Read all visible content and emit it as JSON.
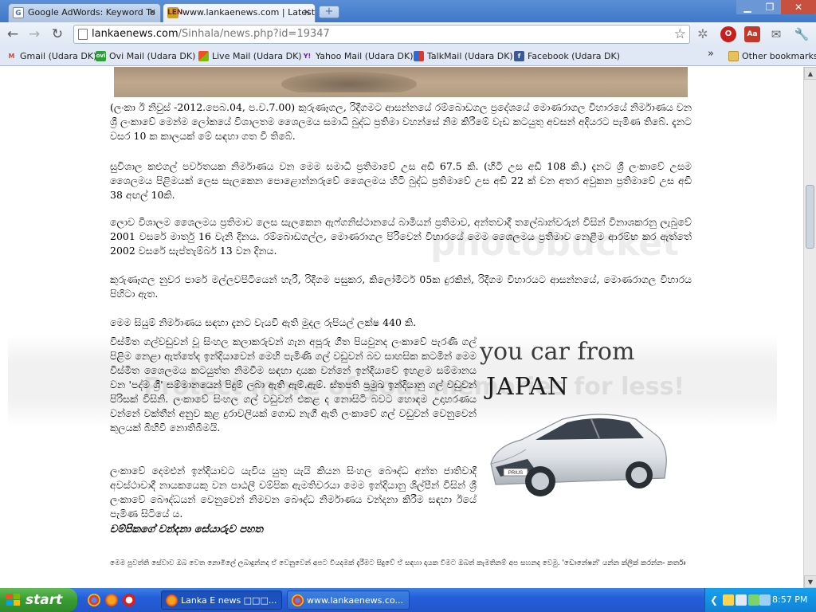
{
  "browser": {
    "tabs": [
      {
        "title": "Google AdWords: Keyword To",
        "favicon": "G",
        "active": false
      },
      {
        "title": "www.lankaenews.com | Latest",
        "favicon": "LEN",
        "active": true
      }
    ],
    "new_tab": "+",
    "url_host": "lankaenews.com",
    "url_path": "/Sinhala/news.php?id=19347"
  },
  "bookmarks": [
    {
      "label": "Gmail (Udara DK)",
      "icon": "M"
    },
    {
      "label": "Ovi Mail (Udara DK)",
      "icon": "ovi"
    },
    {
      "label": "Live Mail (Udara DK)",
      "icon": "W"
    },
    {
      "label": "Yahoo Mail (Udara DK)",
      "icon": "Y!"
    },
    {
      "label": "TalkMail (Udara DK)",
      "icon": "T"
    },
    {
      "label": "Facebook (Udara DK)",
      "icon": "f"
    }
  ],
  "other_bookmarks": "Other bookmarks",
  "article": {
    "p1": "(ලංකා ඊ නිවුස් -2012.පෙබ.04, ප.ව.7.00) කුරුණෑගල, රිදීගමට ආසන්නයේ රම්බොඩගල ප්‍රදේශයේ මොණරාගල විහාරයේ නිර්මාණය වන ශ්‍රී ලංකාවේ මෙන්ම ලෝකයේ විශාලතම ශෛලමය සමාධි බුද්ධ ප්‍රතිමා වහන්සේ නිම කිරීමේ වැඩ කටයුතු අවසන් අදියරට පැමිණ තිබේ. දැනට වසර 10 ක කාලයක් මේ සඳහා ගත වී තිබේ.",
    "p2": "සුවිශාල කළුගල් පර්වතයක නිර්මාණය වන මෙම සමාධි ප්‍රතිමාවේ උස අඩි 67.5 කි. (හිටි උස අඩි 108 කි.) දැනට ශ්‍රී ලංකාවේ උසම ශෛලමය පිළිමයක් ලෙස සැලකෙන පොළොන්නරුවේ ශෛලමය හිටි බුද්ධ ප්‍රතිමාවේ උස අඩි 22 ක් වන අතර අවුකන ප්‍රතිමාවේ උස අඩි 38 අඟල් 10කි.",
    "p3": "ලොව විශාලම ශෛලමය ප්‍රතිමාව ලෙස සැලකෙන ඇෆ්ගනිස්ථානයේ බාමියන් ප්‍රතිමාව, අන්තවාදී තලේබාන්වරුන් විසින් විනාශකරනු ලැබුවේ 2001 වසරේ මාර්තු 16 වැනි දිනය. රම්බොඩගල්ල, මොණරාගල පිරිවෙන් විහාරයේ මෙම ශෛලමය ප්‍රතිමාව නෙළීම ආරම්භ කර ඇත්තේ 2002 වසරේ සැප්තැම්බර් 13 වන දිනය.",
    "p4": "කුරුණෑගල නුවර පාරේ මල්ලවපිටියෙන් හැරී, රිදීගම පසුකර, කිලෝමීටර් 05ක දුරකින්, රිදීගම විහාරයට ආසන්නයේ, මොණරාගල විහාරය පිහිටා ඇත.",
    "p5": "මෙම සියුම් නිර්මාණය සඳහා දැනට වැයවී ඇති මුදල රුපියල් ලක්ෂ 440 කි.",
    "p6": "විස්මිත ගල්වඩුවන් වූ සිංහල කලාකරුවන් ගැන අපූරු ගීත පියවුනද ලංකාවේ පැරණි ගල් පිළිම නෙළා ඇත්තේද ඉන්දියාවෙන් මෙහි පැමිණි ගල් වඩුවන් බව සාහසික කටමින් මෙම විස්මිත ශෛලමය කටයුත්ත නිමවීම සඳහා දායක වන්නේ ඉන්දියාවේ ඉහළම සම්මානය වන 'පද්ම ශ්‍රී' සම්මානයෙන් පිදුම් ලබා ඇති ඇම්.ඇම්. ස්තපති ප්‍රමුඛ ඉන්දියානු ගල් වඩුවන් පිරිසක් විසිනි. ලංකාවේ සිංහල ගල් වඩුවන් එකළ ද නොසිටි බවට හොඳම උදාහරණය වන්නේ වක්තීන් අනුව කුළ දුරාවලියක් ගොඩ නැගී ඇති ලංකාවේ ගල් වඩුවන් වෙනුවෙන් කුලයක් බිහිවී නොතිබීමයි.",
    "p7": "ලංකාවේ දෙමළුන් ඉන්දියාවට යැවිය යුතු යැයි කියන සිංහල බෞද්ධ අන්ත ජාතිවාදී අවස්ථාවාදී නායකයෙකු වන පාඨලී චම්පික ඇමතිවරයා මෙම ඉන්දියානු ශිල්පීන් විසින් ශ්‍රී ලංකාවේ බෞද්ධයන් වෙනුවෙන් නිමවන බෞද්ධ නිර්මාණය වන්දනා කිරීම සඳහා ඊයේ පැමිණ සිටියේ ය.",
    "caption": "චම්පිකගේ වන්දනා සේයාරුව පහත",
    "footer_note": "මෙම පුවත්ති සේවාව ඔබ වෙත නොමිලේ ලබාදුන්නද ඒ වෙනුවෙන් අපට වියදමක් දැරීමට සිදුවේ ඒ සඳහා දායක වීමට ඔබත් කැමතිනම් අප සහනද වෙමු. 'ඩොනේෂන්' යන්න ක්ලික් කරන්න- කර්තෘ"
  },
  "ad": {
    "line1": "you car from",
    "line2": "JAPAN",
    "plate": "PRIUS"
  },
  "watermark": {
    "text1": "photobucket",
    "text2": "Protect more of your memories for less!"
  },
  "taskbar": {
    "start": "start",
    "tasks": [
      {
        "label": "Lanka E news □□□..."
      },
      {
        "label": "www.lankaenews.co..."
      }
    ],
    "clock": "8:57 PM"
  }
}
